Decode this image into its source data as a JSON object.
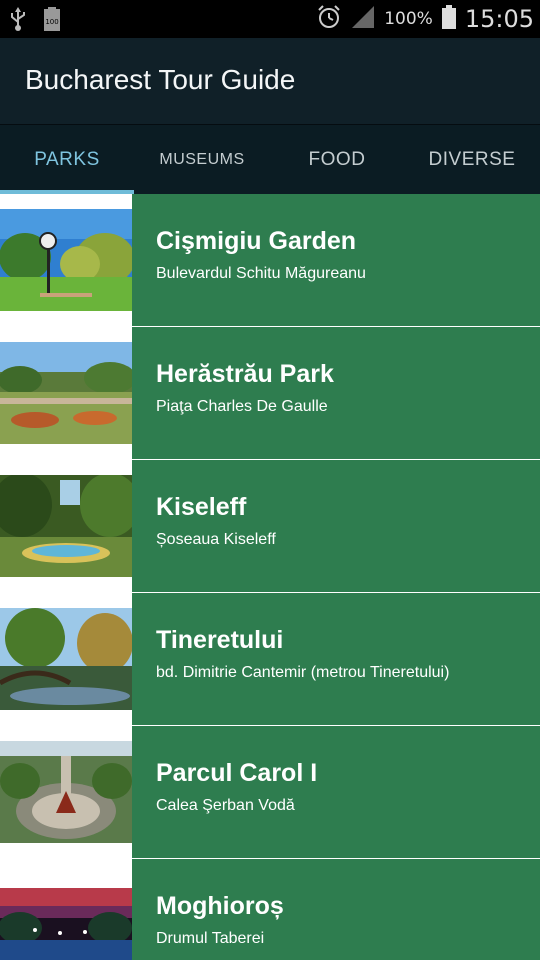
{
  "status_bar": {
    "battery_percent": "100%",
    "time": "15:05",
    "icons": [
      "usb-icon",
      "battery-full-notification-icon",
      "alarm-icon",
      "signal-icon",
      "battery-icon"
    ]
  },
  "app": {
    "title": "Bucharest Tour Guide"
  },
  "tabs": [
    {
      "label": "PARKS",
      "active": true
    },
    {
      "label": "MUSEUMS",
      "active": false
    },
    {
      "label": "FOOD",
      "active": false
    },
    {
      "label": "DIVERSE",
      "active": false
    }
  ],
  "places": [
    {
      "name": "Cişmigiu Garden",
      "address": "Bulevardul Schitu Măgureanu"
    },
    {
      "name": "Herăstrău Park",
      "address": "Piaţa Charles De Gaulle"
    },
    {
      "name": "Kiseleff",
      "address": "Șoseaua Kiseleff"
    },
    {
      "name": "Tineretului",
      "address": "bd. Dimitrie Cantemir (metrou Tineretului)"
    },
    {
      "name": "Parcul Carol I",
      "address": "Calea Şerban Vodă"
    },
    {
      "name": "Moghioroș",
      "address": "Drumul Taberei"
    }
  ],
  "colors": {
    "row_panel": "#2e7d4f",
    "action_bar": "#102028",
    "tab_bar": "#0b1c23",
    "tab_indicator": "#6fbcd8"
  }
}
